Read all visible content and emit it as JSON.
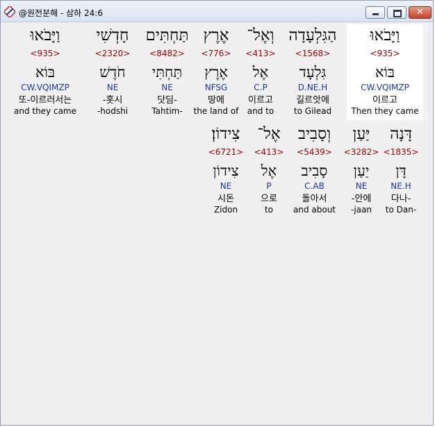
{
  "window": {
    "title": "@원전분해 - 삼하 24:6"
  },
  "rows": [
    [
      {
        "heb": "וַיָּבֹאוּ",
        "strong": "<935>",
        "root": "בּוֹא",
        "morph": "CW.VQIMZP",
        "kor": "이르고",
        "eng": "Then they came",
        "selected": true
      },
      {
        "heb": "הַגִּלְעָדָה",
        "strong": "<1568>",
        "root": "גִּלְעָד",
        "morph": "D.NE.H",
        "kor": "길르앗에",
        "eng": "to Gilead"
      },
      {
        "heb": "וְאֶל־",
        "strong": "<413>",
        "root": "אֶל",
        "morph": "C.P",
        "kor": "이르고",
        "eng": "and to"
      },
      {
        "heb": "אֶרֶץ",
        "strong": "<776>",
        "root": "אֶרֶץ",
        "morph": "NFSG",
        "kor": "땅에",
        "eng": "the land of"
      },
      {
        "heb": "תַּחְתִּים",
        "strong": "<8482>",
        "root": "תַּחְתִּי",
        "morph": "NE",
        "kor": "닷딤-",
        "eng": "Tahtim-"
      },
      {
        "heb": "חָדְשִׁי",
        "strong": "<2320>",
        "root": "חֹדֶשׁ",
        "morph": "NE",
        "kor": "-홋시",
        "eng": "-hodshi"
      },
      {
        "heb": "וַיָּבֹאוּ",
        "strong": "<935>",
        "root": "בּוֹא",
        "morph": "CW.VQIMZP",
        "kor": "또-이르러서는",
        "eng": "and they came"
      }
    ],
    [
      {
        "heb": "דָּנָה",
        "strong": "<1835>",
        "root": "דָּן",
        "morph": "NE.H",
        "kor": "다나-",
        "eng": "to Dan-"
      },
      {
        "heb": "יַּעַן",
        "strong": "<3282>",
        "root": "יַעַן",
        "morph": "NE",
        "kor": "-안에",
        "eng": "-jaan"
      },
      {
        "heb": "וְסָבִיב",
        "strong": "<5439>",
        "root": "סָבִיב",
        "morph": "C.AB",
        "kor": "돌아서",
        "eng": "and about"
      },
      {
        "heb": "אֶל־",
        "strong": "<413>",
        "root": "אֶל",
        "morph": "P",
        "kor": "으로",
        "eng": "to"
      },
      {
        "heb": "צִידוֹן׃",
        "strong": "<6721>",
        "root": "צִידוֹן",
        "morph": "NE",
        "kor": "시돈",
        "eng": "Zidon"
      }
    ]
  ]
}
